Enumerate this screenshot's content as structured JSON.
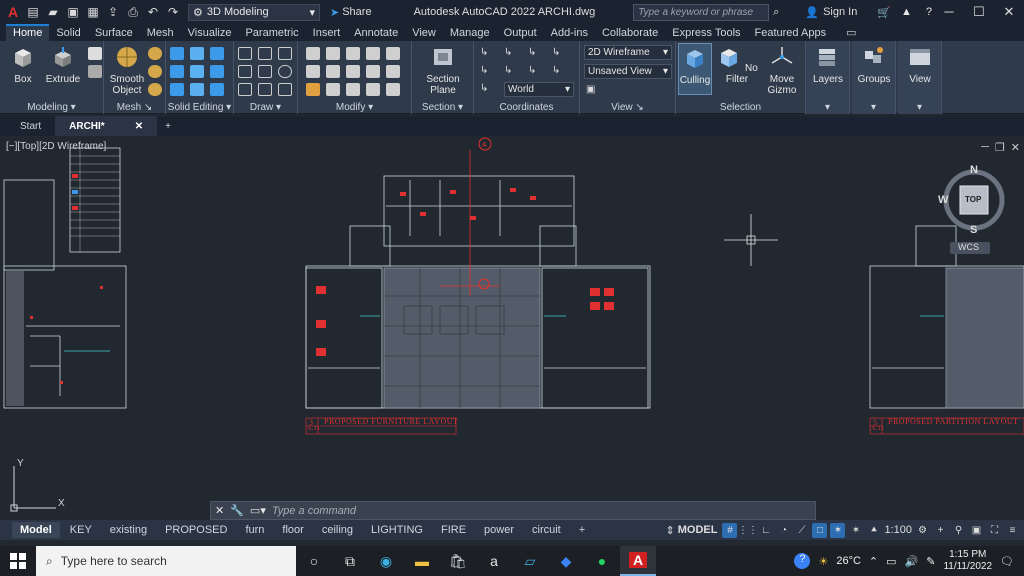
{
  "titlebar": {
    "workspace": "3D Modeling",
    "share": "Share",
    "title": "Autodesk AutoCAD 2022   ARCHI.dwg",
    "search_placeholder": "Type a keyword or phrase",
    "sign_in": "Sign In"
  },
  "ribbon_tabs": [
    "Home",
    "Solid",
    "Surface",
    "Mesh",
    "Visualize",
    "Parametric",
    "Insert",
    "Annotate",
    "View",
    "Manage",
    "Output",
    "Add-ins",
    "Collaborate",
    "Express Tools",
    "Featured Apps"
  ],
  "ribbon": {
    "modeling": {
      "title": "Modeling",
      "box": "Box",
      "extrude": "Extrude"
    },
    "mesh": {
      "title": "Mesh",
      "smooth_object": "Smooth Object"
    },
    "solid_editing": {
      "title": "Solid Editing"
    },
    "draw": {
      "title": "Draw"
    },
    "modify": {
      "title": "Modify"
    },
    "section": {
      "title": "Section",
      "section_plane": "Section Plane"
    },
    "coordinates": {
      "title": "Coordinates",
      "ucs": "World"
    },
    "view": {
      "title": "View",
      "visual_style": "2D Wireframe",
      "saved_view": "Unsaved View"
    },
    "selection": {
      "title": "Selection",
      "culling": "Culling",
      "no_filter": "No Filter",
      "move_gizmo": "Move Gizmo"
    },
    "layers": "Layers",
    "groups": "Groups",
    "view_btn": "View"
  },
  "file_tabs": {
    "start": "Start",
    "archi": "ARCHI*"
  },
  "viewport": {
    "label": "[−][Top][2D Wireframe]",
    "cube_top": "TOP",
    "n": "N",
    "s": "S",
    "w": "W",
    "wcs": "WCS"
  },
  "drawing": {
    "title1": "PROPOSED FURNITURE LAYOUT",
    "title2": "PROPOSED PARTITION LAYOUT",
    "tag1": "3",
    "tag2": "5",
    "sheet": "A.11",
    "grid_marker": "A"
  },
  "command": {
    "placeholder": "Type a command"
  },
  "layout_tabs": [
    "Model",
    "KEY",
    "existing",
    "PROPOSED",
    "furn",
    "floor",
    "ceiling",
    "LIGHTING",
    "FIRE",
    "power",
    "circuit"
  ],
  "status": {
    "model": "MODEL",
    "scale": "1:100"
  },
  "taskbar": {
    "search": "Type here to search",
    "temp": "26°C",
    "time": "1:15 PM",
    "date": "11/11/2022"
  }
}
